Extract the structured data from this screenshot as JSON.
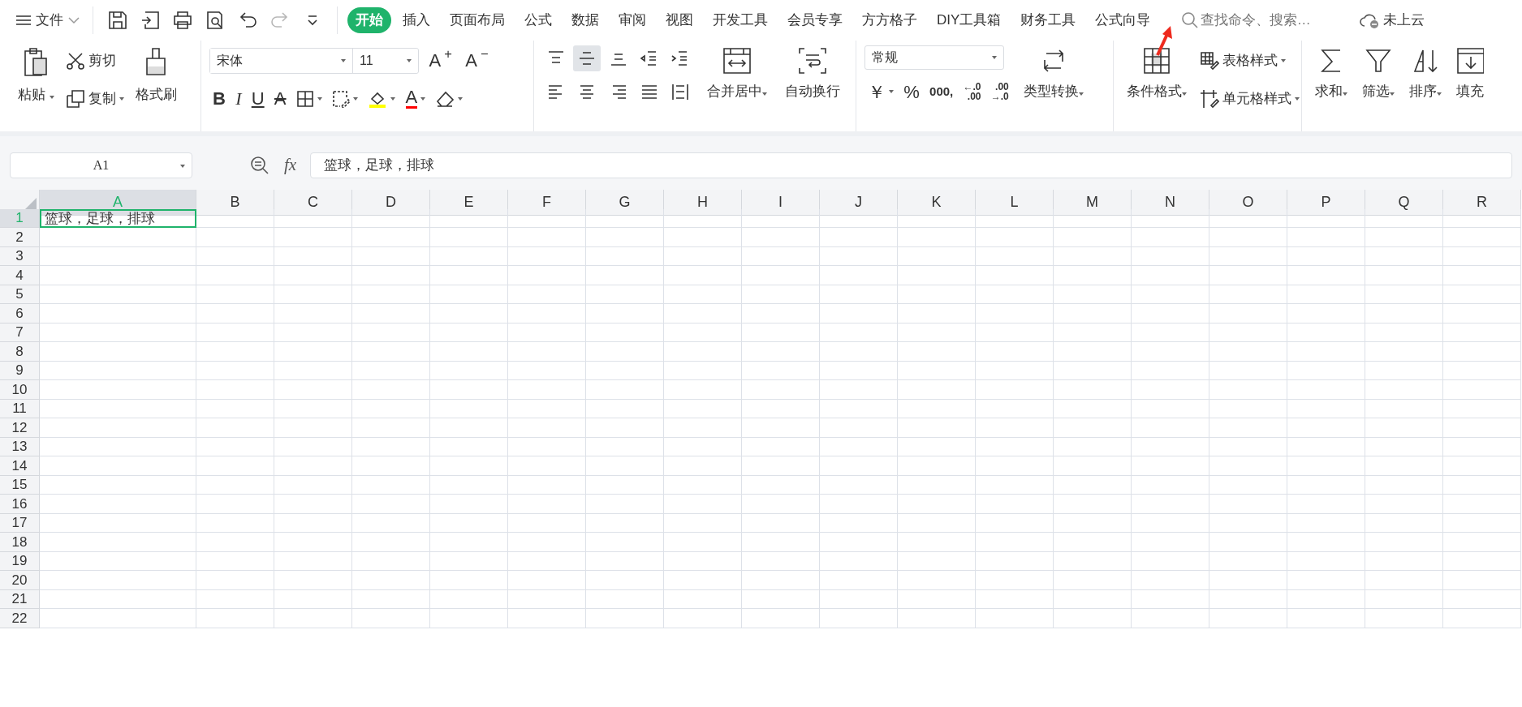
{
  "app_menu": {
    "label": "文件"
  },
  "quick_tools": [
    {
      "kind": "save",
      "disabled": false
    },
    {
      "kind": "export",
      "disabled": false
    },
    {
      "kind": "print",
      "disabled": false
    },
    {
      "kind": "preview",
      "disabled": false
    },
    {
      "kind": "undo",
      "disabled": false
    },
    {
      "kind": "redo",
      "disabled": true
    },
    {
      "kind": "more",
      "disabled": false
    }
  ],
  "tabs": [
    {
      "label": "开始",
      "selected": true
    },
    {
      "label": "插入",
      "selected": false
    },
    {
      "label": "页面布局",
      "selected": false
    },
    {
      "label": "公式",
      "selected": false
    },
    {
      "label": "数据",
      "selected": false
    },
    {
      "label": "审阅",
      "selected": false
    },
    {
      "label": "视图",
      "selected": false
    },
    {
      "label": "开发工具",
      "selected": false
    },
    {
      "label": "会员专享",
      "selected": false
    },
    {
      "label": "方方格子",
      "selected": false
    },
    {
      "label": "DIY工具箱",
      "selected": false
    },
    {
      "label": "财务工具",
      "selected": false
    },
    {
      "label": "公式向导",
      "selected": false
    }
  ],
  "search": {
    "placeholder": "查找命令、搜索…"
  },
  "cloud_status": "未上云",
  "ribbon": {
    "clipboard": {
      "paste": "粘贴",
      "cut": "剪切",
      "copy": "复制",
      "format_painter": "格式刷"
    },
    "font": {
      "name": "宋体",
      "size": "11",
      "grow": "A$^{+}$",
      "shrink": "A$^{−}$",
      "buttons": [
        {
          "kind": "bold",
          "label": "B"
        },
        {
          "kind": "italic",
          "label": "I"
        },
        {
          "kind": "underline",
          "label": "U"
        },
        {
          "kind": "strike",
          "label": "A"
        },
        {
          "kind": "borders"
        },
        {
          "kind": "cellformat"
        },
        {
          "kind": "fill",
          "color": "#ffff00"
        },
        {
          "kind": "fontcolor",
          "label": "A",
          "color": "#ff0000"
        },
        {
          "kind": "clear"
        }
      ]
    },
    "alignment": {
      "buttons": [
        {
          "kind": "top",
          "selected": false
        },
        {
          "kind": "middle",
          "selected": true
        },
        {
          "kind": "bottom",
          "selected": false
        },
        {
          "kind": "outdent",
          "selected": false
        },
        {
          "kind": "indent",
          "selected": false
        },
        {
          "kind": "left",
          "selected": false
        },
        {
          "kind": "center",
          "selected": false
        },
        {
          "kind": "right",
          "selected": false
        },
        {
          "kind": "justify",
          "selected": false
        },
        {
          "kind": "distributed",
          "selected": false
        }
      ],
      "merge": "合并居中",
      "wrap": "自动换行"
    },
    "number": {
      "format": "常规",
      "currency": "￥",
      "percent": "%",
      "thousands": "000,",
      "increase_decimal": "←.0\n.00",
      "decrease_decimal": ".00\n→.0",
      "convert": "类型转换"
    },
    "styles": {
      "conditional": "条件格式",
      "table_style": "表格样式",
      "cell_style": "单元格样式"
    },
    "editing": [
      {
        "kind": "sum",
        "label": "求和"
      },
      {
        "kind": "filter",
        "label": "筛选"
      },
      {
        "kind": "sort",
        "label": "排序"
      },
      {
        "kind": "fill",
        "label": "填充"
      }
    ]
  },
  "name_box": "A1",
  "function_label": "fx",
  "formula": "篮球，足球，排球",
  "columns": [
    {
      "label": "A",
      "selected": true
    },
    {
      "label": "B",
      "selected": false
    },
    {
      "label": "C",
      "selected": false
    },
    {
      "label": "D",
      "selected": false
    },
    {
      "label": "E",
      "selected": false
    },
    {
      "label": "F",
      "selected": false
    },
    {
      "label": "G",
      "selected": false
    },
    {
      "label": "H",
      "selected": false
    },
    {
      "label": "I",
      "selected": false
    },
    {
      "label": "J",
      "selected": false
    },
    {
      "label": "K",
      "selected": false
    },
    {
      "label": "L",
      "selected": false
    },
    {
      "label": "M",
      "selected": false
    },
    {
      "label": "N",
      "selected": false
    },
    {
      "label": "O",
      "selected": false
    },
    {
      "label": "P",
      "selected": false
    },
    {
      "label": "Q",
      "selected": false
    },
    {
      "label": "R",
      "selected": false
    }
  ],
  "rows": [
    {
      "label": "1",
      "selected": true,
      "cells": [
        "篮球，足球，排球"
      ]
    },
    {
      "label": "2",
      "selected": false
    },
    {
      "label": "3",
      "selected": false
    },
    {
      "label": "4",
      "selected": false
    },
    {
      "label": "5",
      "selected": false
    },
    {
      "label": "6",
      "selected": false
    },
    {
      "label": "7",
      "selected": false
    },
    {
      "label": "8",
      "selected": false
    },
    {
      "label": "9",
      "selected": false
    },
    {
      "label": "10",
      "selected": false
    },
    {
      "label": "11",
      "selected": false
    },
    {
      "label": "12",
      "selected": false
    },
    {
      "label": "13",
      "selected": false
    },
    {
      "label": "14",
      "selected": false
    },
    {
      "label": "15",
      "selected": false
    },
    {
      "label": "16",
      "selected": false
    },
    {
      "label": "17",
      "selected": false
    },
    {
      "label": "18",
      "selected": false
    },
    {
      "label": "19",
      "selected": false
    },
    {
      "label": "20",
      "selected": false
    },
    {
      "label": "21",
      "selected": false
    },
    {
      "label": "22",
      "selected": false
    }
  ]
}
